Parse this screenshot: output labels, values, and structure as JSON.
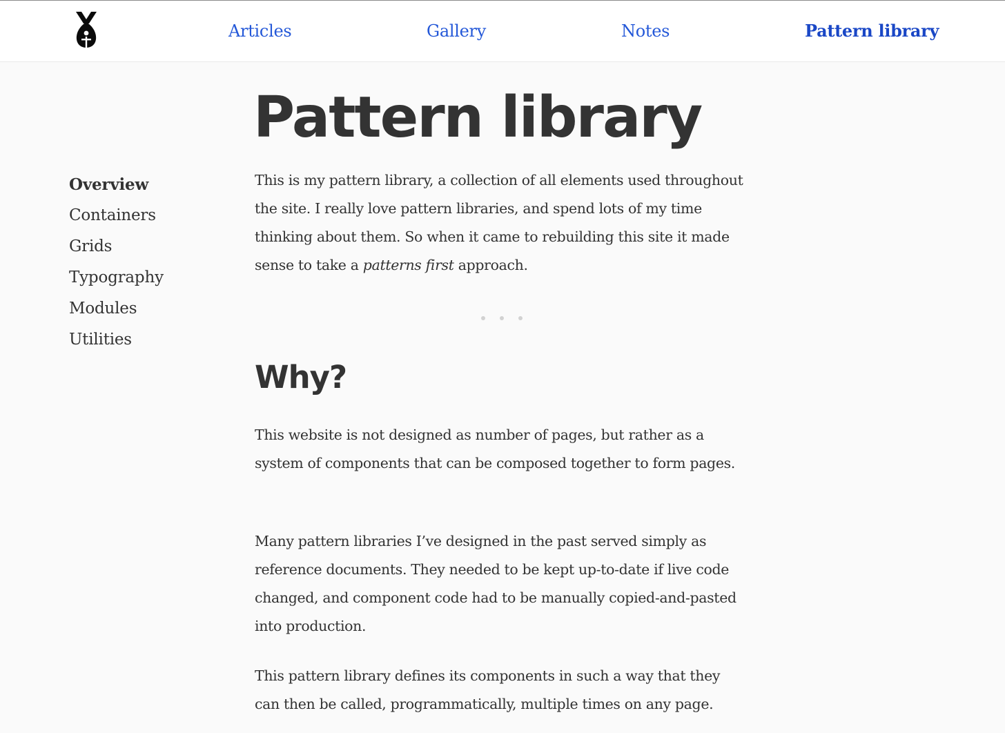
{
  "header": {
    "logo_icon": "bunny-logo-icon",
    "nav": [
      {
        "label": "Articles",
        "active": false
      },
      {
        "label": "Gallery",
        "active": false
      },
      {
        "label": "Notes",
        "active": false
      },
      {
        "label": "Pattern library",
        "active": true
      }
    ],
    "link_color": "#2458d8"
  },
  "sidebar": {
    "items": [
      {
        "label": "Overview",
        "active": true
      },
      {
        "label": "Containers",
        "active": false
      },
      {
        "label": "Grids",
        "active": false
      },
      {
        "label": "Typography",
        "active": false
      },
      {
        "label": "Modules",
        "active": false
      },
      {
        "label": "Utilities",
        "active": false
      }
    ]
  },
  "main": {
    "title": "Pattern library",
    "intro": {
      "before": "This is my pattern library, a collection of all elements used throughout the site. I really love pattern libraries, and spend lots of my time thinking about them. So when it came to rebuilding this site it made sense to take a ",
      "emphasis": "patterns first",
      "after": " approach."
    },
    "section_title": "Why?",
    "paragraphs": [
      "This website is not designed as number of pages, but rather as a system of components that can be composed together to form pages.",
      "Many pattern libraries I’ve designed in the past served simply as reference documents. They needed to be kept up-to-date if live code changed, and component code had to be manually copied-and-pasted into production.",
      "This pattern library defines its components in such a way that they can then be called, programmatically, multiple times on any page."
    ]
  },
  "colors": {
    "text": "#333333",
    "background": "#fafafa",
    "header_background": "#ffffff",
    "divider_dot": "#d2d2d2"
  }
}
